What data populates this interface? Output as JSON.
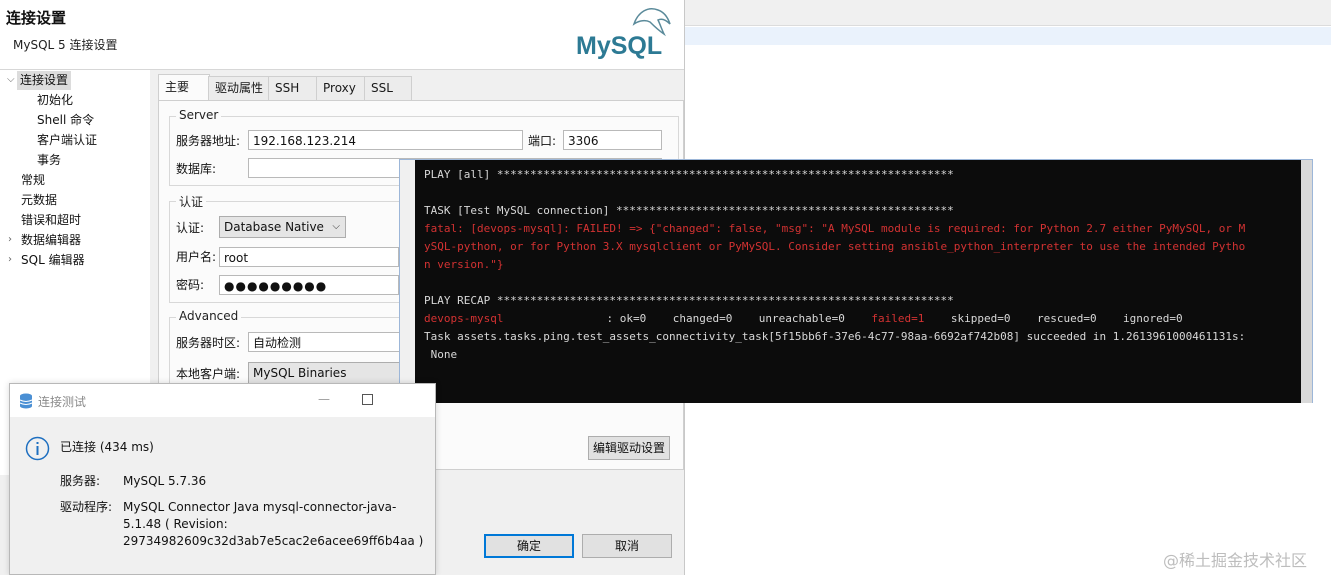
{
  "dialog": {
    "title": "连接设置",
    "subtitle": "MySQL 5 连接设置",
    "logo_text": "MySQL"
  },
  "tree": {
    "items": [
      {
        "label": "连接设置"
      },
      {
        "label": "初始化"
      },
      {
        "label": "Shell 命令"
      },
      {
        "label": "客户端认证"
      },
      {
        "label": "事务"
      },
      {
        "label": "常规"
      },
      {
        "label": "元数据"
      },
      {
        "label": "错误和超时"
      },
      {
        "label": "数据编辑器"
      },
      {
        "label": "SQL 编辑器"
      }
    ]
  },
  "tabs": [
    {
      "label": "主要"
    },
    {
      "label": "驱动属性"
    },
    {
      "label": "SSH"
    },
    {
      "label": "Proxy"
    },
    {
      "label": "SSL"
    }
  ],
  "server": {
    "group_title": "Server",
    "host_label": "服务器地址:",
    "host_value": "192.168.123.214",
    "port_label": "端口:",
    "port_value": "3306",
    "database_label": "数据库:",
    "database_value": ""
  },
  "auth": {
    "group_title": "认证",
    "auth_label": "认证:",
    "auth_value": "Database Native",
    "user_label": "用户名:",
    "user_value": "root",
    "password_label": "密码:",
    "password_value": "●●●●●●●●●"
  },
  "advanced": {
    "group_title": "Advanced",
    "timezone_label": "服务器时区:",
    "timezone_value": "自动检测",
    "client_label": "本地客户端:",
    "client_value": "MySQL Binaries"
  },
  "buttons": {
    "edit_driver": "编辑驱动设置",
    "ok": "确定",
    "cancel": "取消"
  },
  "terminal": {
    "line1": "PLAY [all] *********************************************************************",
    "line2": "TASK [Test MySQL connection] ***************************************************",
    "line3": "fatal: [devops-mysql]: FAILED! => {\"changed\": false, \"msg\": \"A MySQL module is required: for Python 2.7 either PyMySQL, or M",
    "line4": "ySQL-python, or for Python 3.X mysqlclient or PyMySQL. Consider setting ansible_python_interpreter to use the intended Pytho",
    "line5": "n version.\"}",
    "line6": "PLAY RECAP *********************************************************************",
    "recap_host": "devops-mysql",
    "recap_ok": ": ok=0    changed=0    unreachable=0    ",
    "recap_failed": "failed=1",
    "recap_rest": "    skipped=0    rescued=0    ignored=0",
    "line8": "Task assets.tasks.ping.test_assets_connectivity_task[5f15bb6f-37e6-4c77-98aa-6692af742b08] succeeded in 1.2613961000461131s:",
    "line9": " None"
  },
  "popup": {
    "title": "连接测试",
    "status": "已连接 (434 ms)",
    "server_label": "服务器:",
    "server_value": "MySQL 5.7.36",
    "driver_label": "驱动程序:",
    "driver_line1": "MySQL Connector Java mysql-connector-java-",
    "driver_line2": "5.1.48 ( Revision:",
    "driver_line3": "29734982609c32d3ab7e5cac2e6acee69ff6b4aa )"
  },
  "watermark": "@稀土掘金技术社区",
  "colors": {
    "terminal_bg": "#0c0c0c",
    "error_red": "#d33232",
    "info_blue": "#1e6fc0",
    "primary_border": "#0078d7"
  }
}
